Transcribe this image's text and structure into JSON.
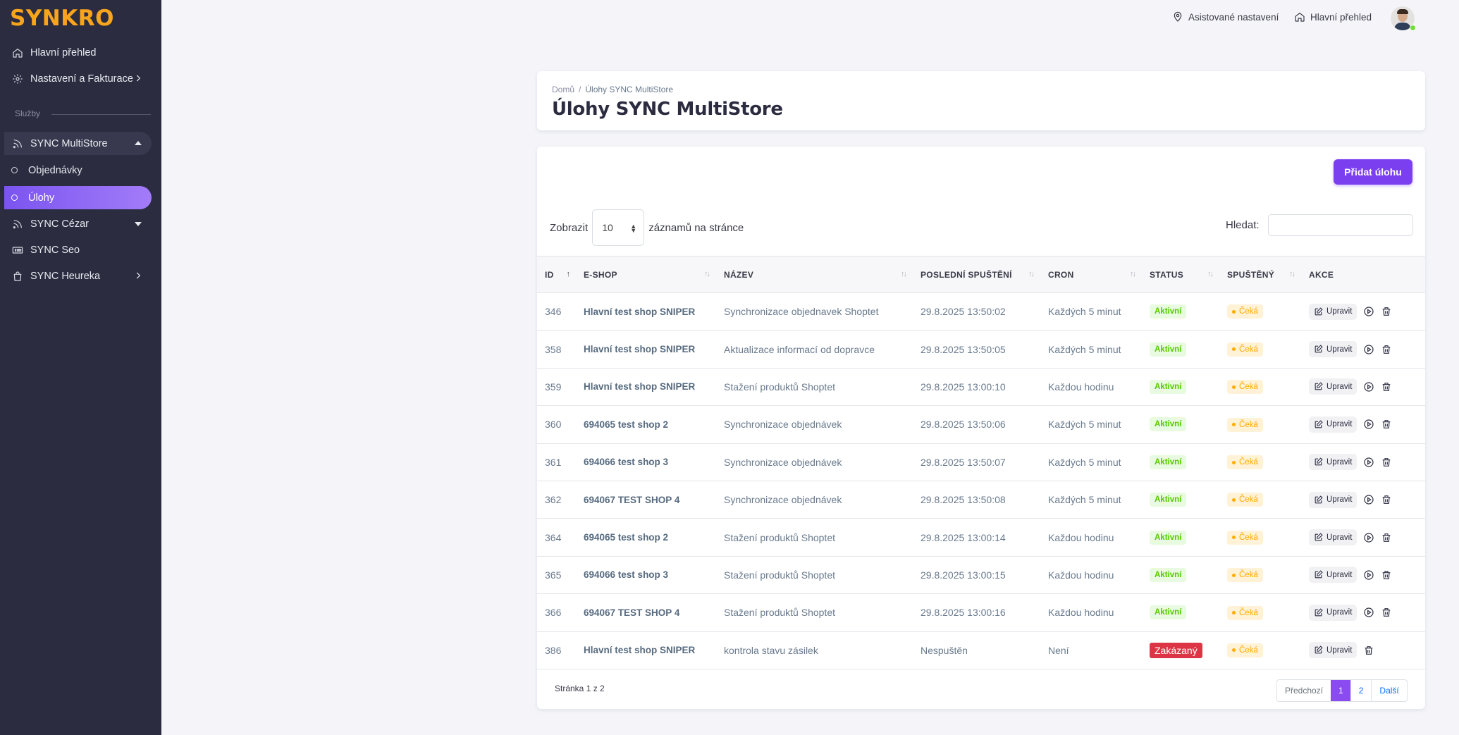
{
  "brand": {
    "logo": "SYNKRO"
  },
  "sidebar": {
    "items": [
      {
        "label": "Hlavní přehled",
        "icon": "home-icon"
      },
      {
        "label": "Nastavení a Fakturace",
        "icon": "gear-icon"
      }
    ],
    "section_label": "Služby",
    "services": [
      {
        "label": "SYNC MultiStore",
        "icon": "rss-icon",
        "expanded": true
      },
      {
        "label": "Objednávky"
      },
      {
        "label": "Úlohy",
        "active": true
      },
      {
        "label": "SYNC Cézar",
        "icon": "rss-icon"
      },
      {
        "label": "SYNC Seo",
        "icon": "seo-icon"
      },
      {
        "label": "SYNC Heureka",
        "icon": "bag-icon"
      }
    ]
  },
  "topbar": {
    "assisted": "Asistované nastavení",
    "overview": "Hlavní přehled"
  },
  "header": {
    "breadcrumb_home": "Domů",
    "breadcrumb_current": "Úlohy SYNC MultiStore",
    "title": "Úlohy SYNC MultiStore"
  },
  "toolbar": {
    "add_label": "Přidat úlohu",
    "show_label": "Zobrazit",
    "page_size": "10",
    "per_page_label": "záznamů na stránce",
    "search_label": "Hledat:"
  },
  "table": {
    "columns": [
      "ID",
      "E-SHOP",
      "NÁZEV",
      "POSLEDNÍ SPUŠTĚNÍ",
      "CRON",
      "STATUS",
      "SPUŠTĚNÝ",
      "AKCE"
    ],
    "edit_label": "Upravit",
    "rows": [
      {
        "id": "346",
        "shop": "Hlavní test shop SNIPER",
        "name": "Synchronizace objednavek Shoptet",
        "last_run": "29.8.2025 13:50:02",
        "cron": "Každých 5 minut",
        "status": "Aktivní",
        "running": "Čeká"
      },
      {
        "id": "358",
        "shop": "Hlavní test shop SNIPER",
        "name": "Aktualizace informací od dopravce",
        "last_run": "29.8.2025 13:50:05",
        "cron": "Každých 5 minut",
        "status": "Aktivní",
        "running": "Čeká"
      },
      {
        "id": "359",
        "shop": "Hlavní test shop SNIPER",
        "name": "Stažení produktů Shoptet",
        "last_run": "29.8.2025 13:00:10",
        "cron": "Každou hodinu",
        "status": "Aktivní",
        "running": "Čeká"
      },
      {
        "id": "360",
        "shop": "694065 test shop 2",
        "name": "Synchronizace objednávek",
        "last_run": "29.8.2025 13:50:06",
        "cron": "Každých 5 minut",
        "status": "Aktivní",
        "running": "Čeká"
      },
      {
        "id": "361",
        "shop": "694066 test shop 3",
        "name": "Synchronizace objednávek",
        "last_run": "29.8.2025 13:50:07",
        "cron": "Každých 5 minut",
        "status": "Aktivní",
        "running": "Čeká"
      },
      {
        "id": "362",
        "shop": "694067 TEST SHOP 4",
        "name": "Synchronizace objednávek",
        "last_run": "29.8.2025 13:50:08",
        "cron": "Každých 5 minut",
        "status": "Aktivní",
        "running": "Čeká"
      },
      {
        "id": "364",
        "shop": "694065 test shop 2",
        "name": "Stažení produktů Shoptet",
        "last_run": "29.8.2025 13:00:14",
        "cron": "Každou hodinu",
        "status": "Aktivní",
        "running": "Čeká"
      },
      {
        "id": "365",
        "shop": "694066 test shop 3",
        "name": "Stažení produktů Shoptet",
        "last_run": "29.8.2025 13:00:15",
        "cron": "Každou hodinu",
        "status": "Aktivní",
        "running": "Čeká"
      },
      {
        "id": "366",
        "shop": "694067 TEST SHOP 4",
        "name": "Stažení produktů Shoptet",
        "last_run": "29.8.2025 13:00:16",
        "cron": "Každou hodinu",
        "status": "Aktivní",
        "running": "Čeká"
      },
      {
        "id": "386",
        "shop": "Hlavní test shop SNIPER",
        "name": "kontrola stavu zásilek",
        "last_run": "Nespuštěn",
        "cron": "Není",
        "status": "Zakázaný",
        "running": "Čeká",
        "no_run_button": true
      }
    ]
  },
  "footer": {
    "info": "Stránka 1 z 2",
    "prev": "Předchozí",
    "pages": [
      "1",
      "2"
    ],
    "current_page": "1",
    "next": "Další"
  },
  "colors": {
    "sidebar_bg": "#2b2c40",
    "accent": "#7b3ff0",
    "logo": "#f8a51c",
    "status_active": "#56ca00",
    "status_disabled": "#dc3545",
    "waiting": "#ffab00"
  }
}
